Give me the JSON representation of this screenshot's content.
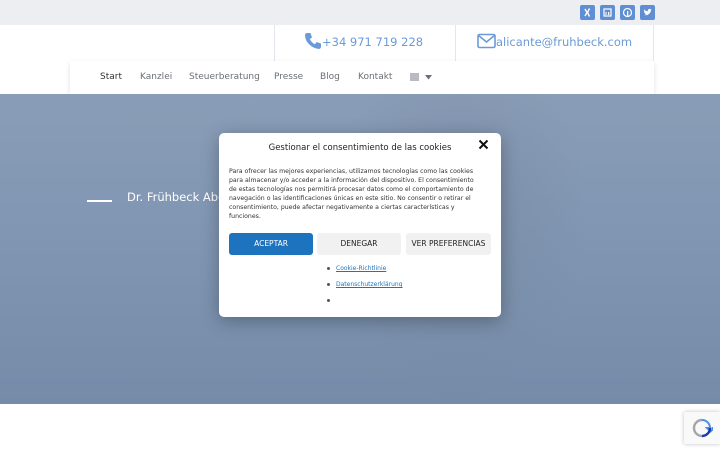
{
  "social": {
    "icons": [
      "xing-icon",
      "linkedin-icon",
      "facebook-icon",
      "twitter-icon"
    ]
  },
  "contact": {
    "phone": "+34 971 719 228",
    "email": "alicante@fruhbeck.com"
  },
  "nav": {
    "items": [
      "Start",
      "Kanzlei",
      "Steuerberatung",
      "Presse",
      "Blog",
      "Kontakt"
    ]
  },
  "hero": {
    "title": "Dr. Frühbeck Abog"
  },
  "cookie": {
    "title": "Gestionar el consentimiento de las cookies",
    "body": "Para ofrecer las mejores experiencias, utilizamos tecnologías como las cookies para almacenar y/o acceder a la información del dispositivo. El consentimiento de estas tecnologías nos permitirá procesar datos como el comportamiento de navegación o las identificaciones únicas en este sitio. No consentir o retirar el consentimiento, puede afectar negativamente a ciertas características y funciones.",
    "accept": "ACEPTAR",
    "deny": "DENEGAR",
    "prefs": "VER PREFERENCIAS",
    "links": [
      "Cookie-Richtlinie",
      "Datenschutzerklärung"
    ]
  },
  "colors": {
    "accent": "#5f8ed3",
    "button_primary": "#1e73be",
    "hero": "#8a9db7"
  }
}
